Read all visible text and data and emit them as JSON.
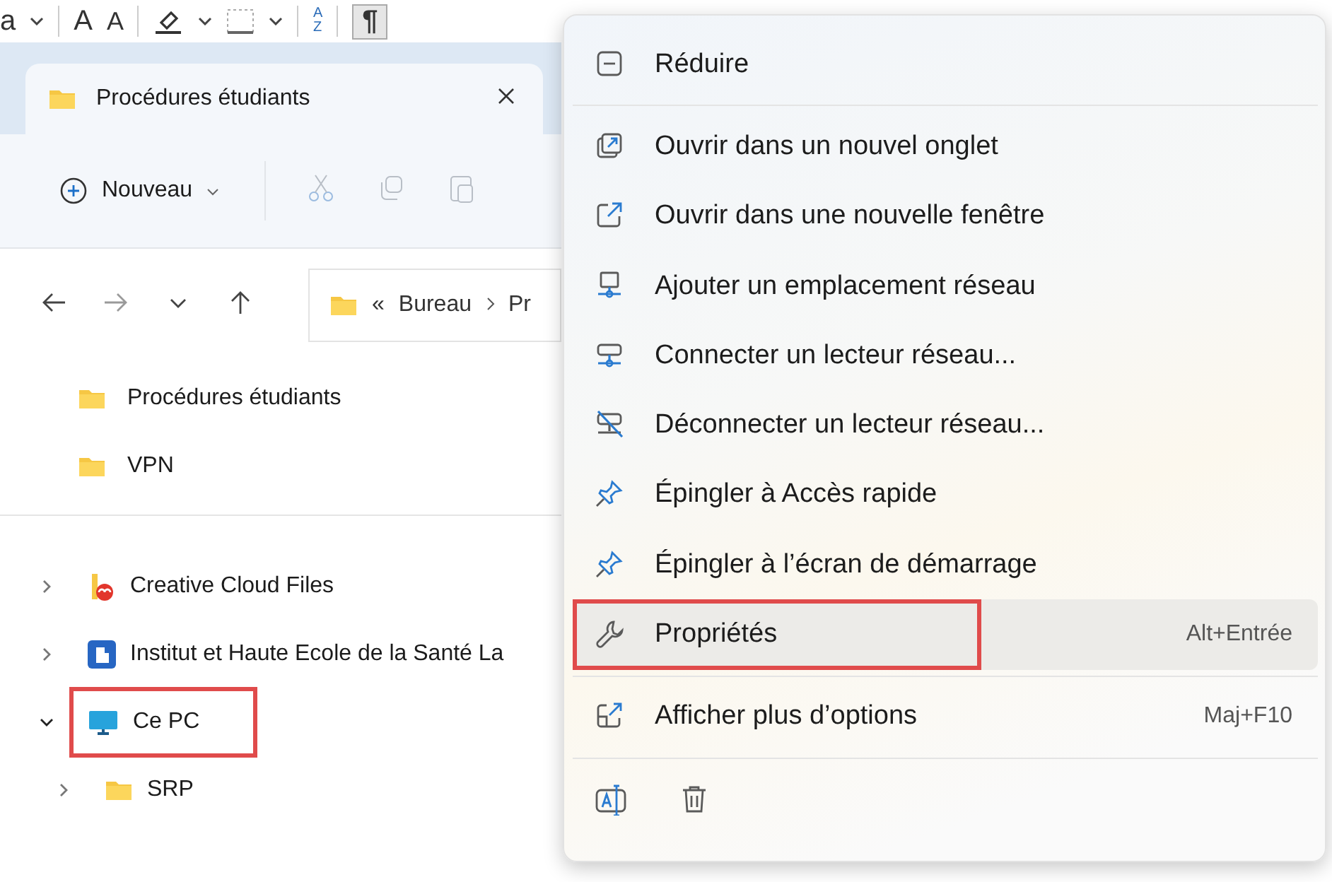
{
  "ribbon": [
    {
      "kind": "fragment",
      "text": "a"
    },
    {
      "kind": "caret"
    },
    {
      "kind": "grow",
      "text": "A"
    },
    {
      "kind": "shrink",
      "text": "A"
    },
    {
      "kind": "highlight"
    },
    {
      "kind": "caret"
    },
    {
      "kind": "borders"
    },
    {
      "kind": "caret"
    },
    {
      "kind": "sort",
      "top": "A",
      "bottom": "Z"
    },
    {
      "kind": "pilcrow",
      "text": "¶",
      "selected": true
    }
  ],
  "explorer": {
    "tab": {
      "title": "Procédures étudiants"
    },
    "toolbar": {
      "new_label": "Nouveau",
      "actions": [
        {
          "kind": "cut",
          "disabled": true
        },
        {
          "kind": "copy",
          "disabled": true
        },
        {
          "kind": "paste",
          "disabled": true
        }
      ]
    },
    "nav": [
      {
        "kind": "back",
        "disabled": false
      },
      {
        "kind": "forward",
        "disabled": true
      },
      {
        "kind": "recent",
        "disabled": false
      },
      {
        "kind": "up",
        "disabled": false
      }
    ],
    "address": {
      "overflow": "«",
      "crumbs": [
        "Bureau",
        "Pr"
      ]
    },
    "quick_access": [
      {
        "label": "Procédures étudiants"
      },
      {
        "label": "VPN"
      }
    ],
    "tree": [
      {
        "label": "Creative Cloud Files",
        "kind": "cloud",
        "expanded": false,
        "annotated": false
      },
      {
        "label": "Institut et Haute Ecole de la Santé La",
        "kind": "org",
        "expanded": false,
        "annotated": false
      },
      {
        "label": "Ce PC",
        "kind": "pc",
        "expanded": true,
        "annotated": true,
        "children": [
          {
            "label": "SRP",
            "kind": "folder",
            "expanded": false,
            "annotated": false
          }
        ]
      }
    ]
  },
  "context_menu": {
    "sections": [
      [
        {
          "kind": "collapse",
          "label": "Réduire",
          "selected": false,
          "annotated": false
        }
      ],
      [
        {
          "kind": "new-tab",
          "label": "Ouvrir dans un nouvel onglet",
          "selected": false,
          "annotated": false
        },
        {
          "kind": "new-window",
          "label": "Ouvrir dans une nouvelle fenêtre",
          "selected": false,
          "annotated": false
        },
        {
          "kind": "add-network",
          "label": "Ajouter un emplacement réseau",
          "selected": false,
          "annotated": false
        },
        {
          "kind": "map-drive",
          "label": "Connecter un lecteur réseau...",
          "selected": false,
          "annotated": false
        },
        {
          "kind": "unmap-drive",
          "label": "Déconnecter un lecteur réseau...",
          "selected": false,
          "annotated": false
        },
        {
          "kind": "pin",
          "label": "Épingler à Accès rapide",
          "selected": false,
          "annotated": false
        },
        {
          "kind": "pin",
          "label": "Épingler à l’écran de démarrage",
          "selected": false,
          "annotated": false
        },
        {
          "kind": "properties",
          "label": "Propriétés",
          "shortcut": "Alt+Entrée",
          "selected": true,
          "annotated": true
        }
      ],
      [
        {
          "kind": "more",
          "label": "Afficher plus d’options",
          "shortcut": "Maj+F10",
          "selected": false,
          "annotated": false
        }
      ]
    ],
    "quick_actions": [
      {
        "kind": "rename"
      },
      {
        "kind": "delete"
      }
    ]
  }
}
